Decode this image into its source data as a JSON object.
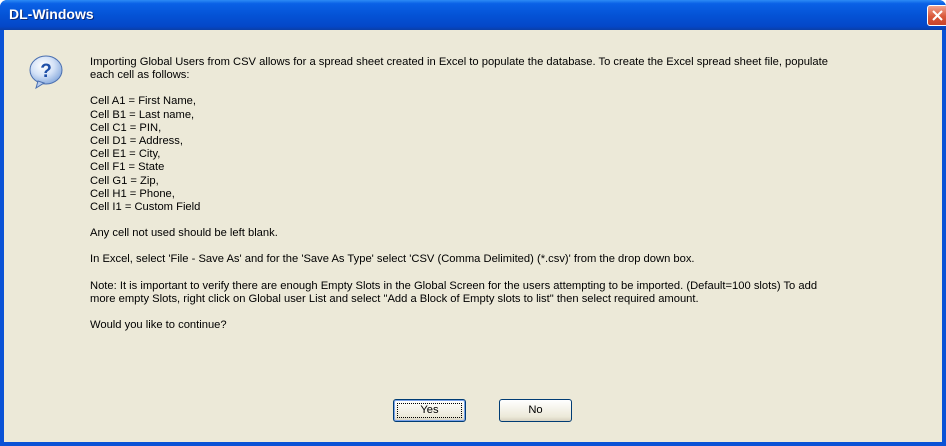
{
  "window": {
    "title": "DL-Windows"
  },
  "message": {
    "intro": "Importing Global Users from CSV allows for a spread sheet created in Excel to populate the database. To create the Excel spread sheet file, populate",
    "intro_cont": "each cell as follows:",
    "cells": [
      "Cell A1 = First Name,",
      "Cell B1 = Last name,",
      "Cell C1 = PIN,",
      "Cell D1 = Address,",
      "Cell E1 = City,",
      "Cell F1 = State",
      "Cell G1 = Zip,",
      "Cell H1 = Phone,",
      "Cell I1 = Custom Field"
    ],
    "blank_note": "Any cell not used should be left blank.",
    "excel_note": "In Excel, select 'File - Save As' and for the 'Save As Type' select 'CSV (Comma Delimited) (*.csv)' from the drop down box.",
    "slots_note_1": "Note: It is important to verify there are enough Empty Slots in the Global Screen for the users attempting to be imported. (Default=100 slots) To add",
    "slots_note_2": "more empty Slots, right click on Global user List and select \"Add a Block of Empty slots to list\" then select required amount.",
    "question": "Would you like to continue?"
  },
  "buttons": {
    "yes": "Yes",
    "no": "No"
  },
  "icons": {
    "dialog": "question-icon",
    "close": "close-icon"
  },
  "colors": {
    "titlebar": "#0453d6",
    "client": "#ece9d8",
    "close_button": "#d9583a"
  }
}
